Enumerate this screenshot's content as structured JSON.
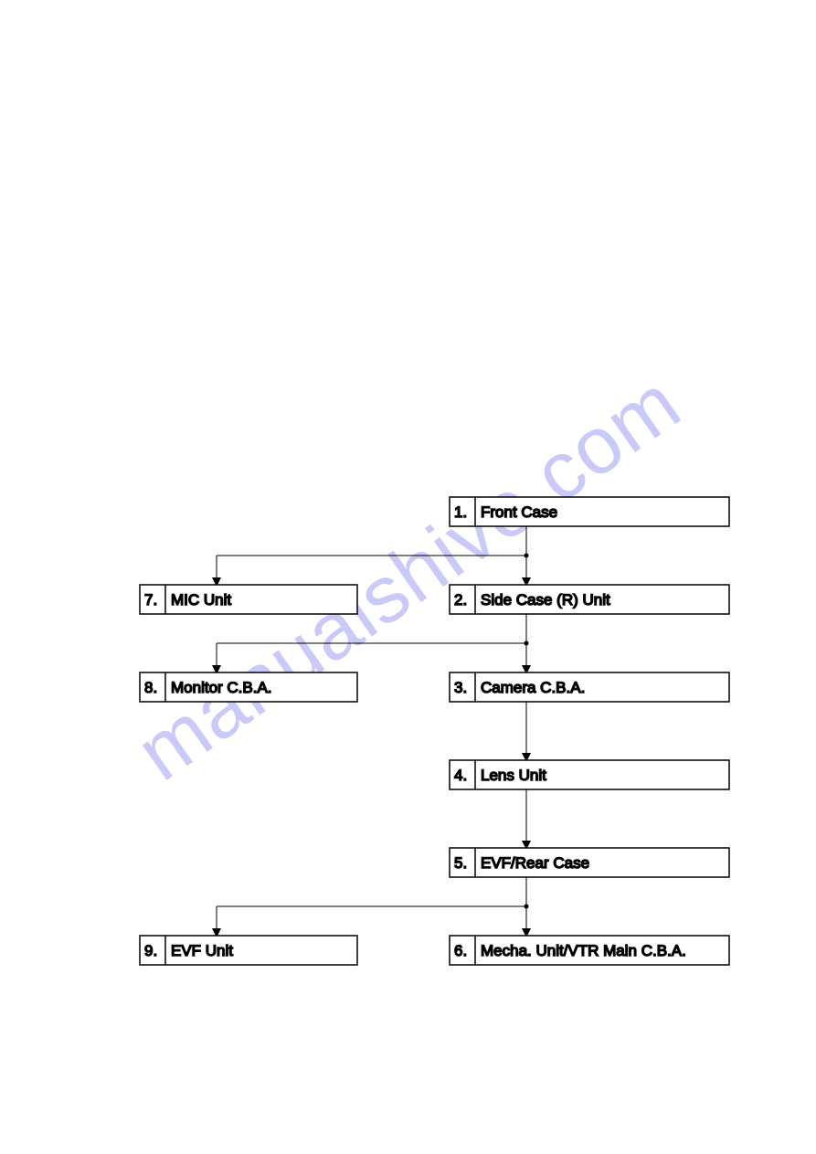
{
  "watermark": "manualshive.com",
  "nodes": {
    "n1": {
      "num": "1.",
      "label": "Front Case"
    },
    "n2": {
      "num": "2.",
      "label": "Side Case (R) Unit"
    },
    "n3": {
      "num": "3.",
      "label": "Camera C.B.A."
    },
    "n4": {
      "num": "4.",
      "label": "Lens Unit"
    },
    "n5": {
      "num": "5.",
      "label": "EVF/Rear Case"
    },
    "n6": {
      "num": "6.",
      "label": "Mecha. Unit/VTR Main C.B.A."
    },
    "n7": {
      "num": "7.",
      "label": "MIC Unit"
    },
    "n8": {
      "num": "8.",
      "label": "Monitor C.B.A."
    },
    "n9": {
      "num": "9.",
      "label": "EVF Unit"
    }
  },
  "diagram": {
    "type": "disassembly-flowchart",
    "edges": [
      {
        "from": "n1",
        "to": "n2"
      },
      {
        "from": "n1",
        "to": "n7"
      },
      {
        "from": "n2",
        "to": "n3"
      },
      {
        "from": "n2",
        "to": "n8"
      },
      {
        "from": "n3",
        "to": "n4"
      },
      {
        "from": "n4",
        "to": "n5"
      },
      {
        "from": "n5",
        "to": "n6"
      },
      {
        "from": "n5",
        "to": "n9"
      }
    ]
  }
}
